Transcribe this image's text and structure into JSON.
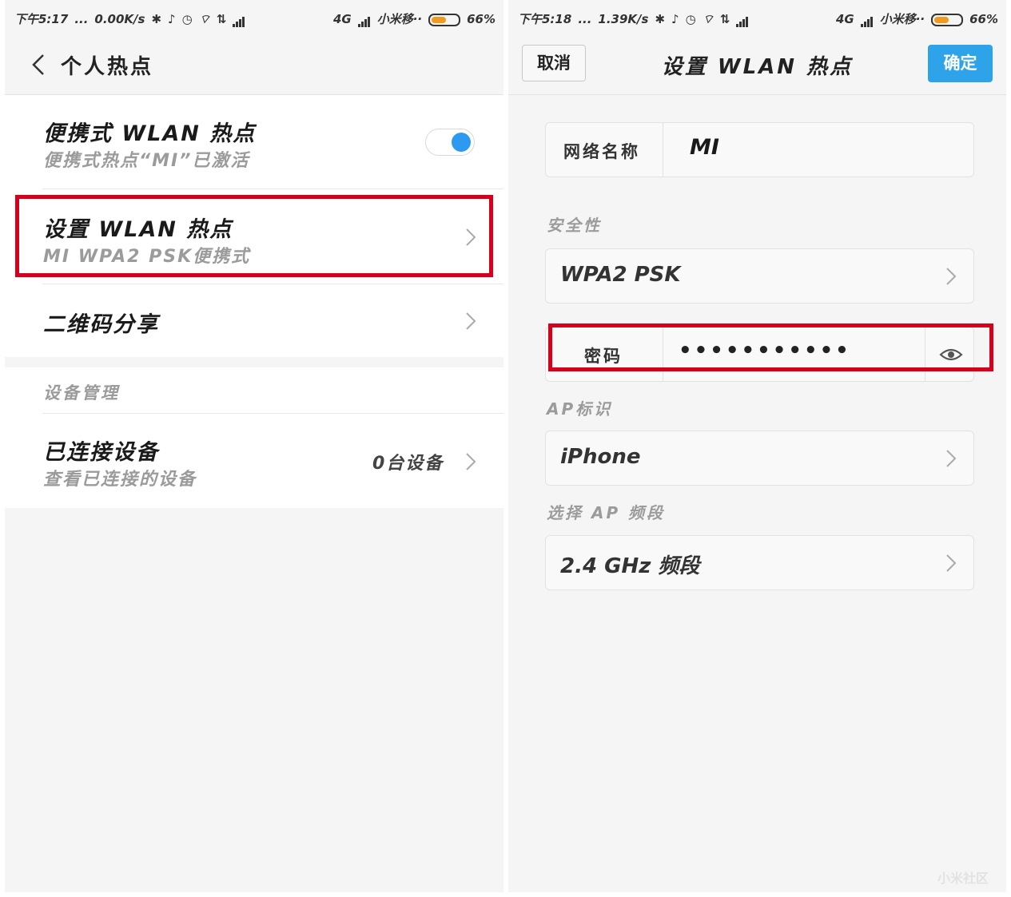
{
  "left": {
    "status": {
      "time": "下午5:17",
      "dots": "...",
      "speed": "0.00K/s",
      "net": "4G",
      "carrier": "小米移··",
      "battery": "66%"
    },
    "header": {
      "title": "个人热点"
    },
    "hotspot": {
      "title": "便携式 WLAN 热点",
      "subtitle": "便携式热点“MI”已激活",
      "enabled": true
    },
    "setup": {
      "title": "设置 WLAN 热点",
      "subtitle": "MI WPA2 PSK便携式"
    },
    "qr": {
      "title": "二维码分享"
    },
    "devices_section": "设备管理",
    "connected": {
      "title": "已连接设备",
      "subtitle": "查看已连接的设备",
      "value": "0台设备"
    }
  },
  "right": {
    "status": {
      "time": "下午5:18",
      "dots": "...",
      "speed": "1.39K/s",
      "net": "4G",
      "carrier": "小米移··",
      "battery": "66%"
    },
    "header": {
      "cancel": "取消",
      "title": "设置 WLAN 热点",
      "confirm": "确定"
    },
    "form": {
      "ssid_label": "网络名称",
      "ssid_value": "MI",
      "security_label": "安全性",
      "security_value": "WPA2 PSK",
      "password_label": "密码",
      "password_value": "•••••••••••",
      "ap_label": "AP标识",
      "ap_value": "iPhone",
      "band_label": "选择 AP 频段",
      "band_value": "2.4 GHz 频段"
    },
    "watermark": "小米社区"
  },
  "colors": {
    "accent": "#2ea3ea",
    "toggle": "#2c9af0",
    "highlight": "#d6001c",
    "battery": "#f39a1e"
  }
}
